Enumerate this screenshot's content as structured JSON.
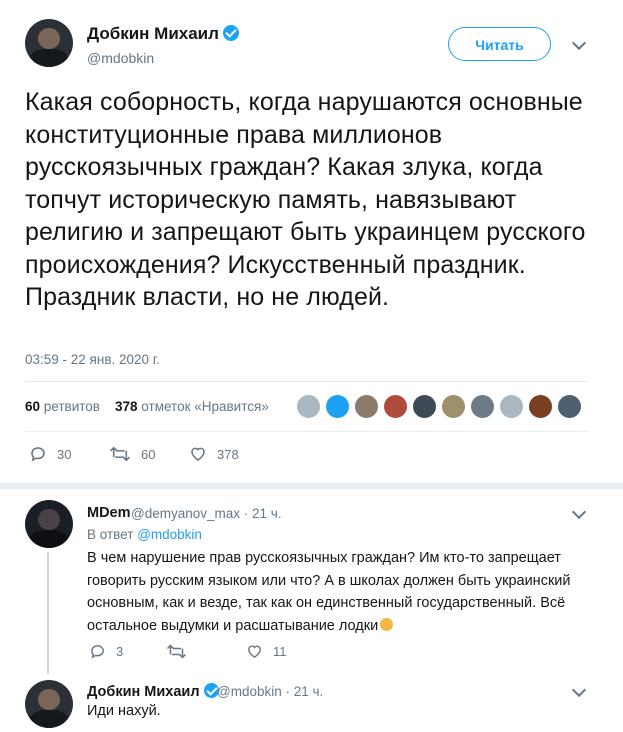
{
  "tweet": {
    "author_name": "Добкин Михаил",
    "author_handle": "@mdobkin",
    "follow_label": "Читать",
    "text": "Какая соборность, когда нарушаются основные конституционные права миллионов русскоязычных граждан? Какая злука, когда топчут историческую память, навязывают религию и запрещают быть украинцем русского происхождения? Искусственный праздник. Праздник власти, но не людей.",
    "timestamp": "03:59 - 22 янв. 2020 г.",
    "retweets_count": "60",
    "retweets_label": "ретвитов",
    "likes_count": "378",
    "likes_label": "отметок «Нравится»",
    "actions": {
      "reply": "30",
      "retweet": "60",
      "like": "378"
    }
  },
  "replies": [
    {
      "author_name": "MDem",
      "author_handle": "@demyanov_max",
      "time": "· 21 ч.",
      "replying_prefix": "В ответ",
      "replying_to": "@mdobkin",
      "text": "В чем нарушение прав русскоязычных граждан? Им кто-то запрещает говорить русским языком или что? А в школах должен быть украинский основным, как и везде, так как он единственный государственный. Всё остальное выдумки и расшатывание лодки",
      "actions": {
        "reply": "3",
        "retweet": "",
        "like": "11"
      }
    },
    {
      "author_name": "Добкин Михаил",
      "author_handle": "@mdobkin",
      "time": "· 21 ч.",
      "text": "Иди нахуй."
    }
  ],
  "icons": {
    "verified": "verified-badge-icon",
    "chevron": "chevron-down-icon",
    "reply": "reply-icon",
    "retweet": "retweet-icon",
    "like": "heart-icon"
  },
  "colors": {
    "accent": "#1da1f2",
    "muted": "#657786",
    "text": "#14171a",
    "divider": "#e6ecf0"
  }
}
